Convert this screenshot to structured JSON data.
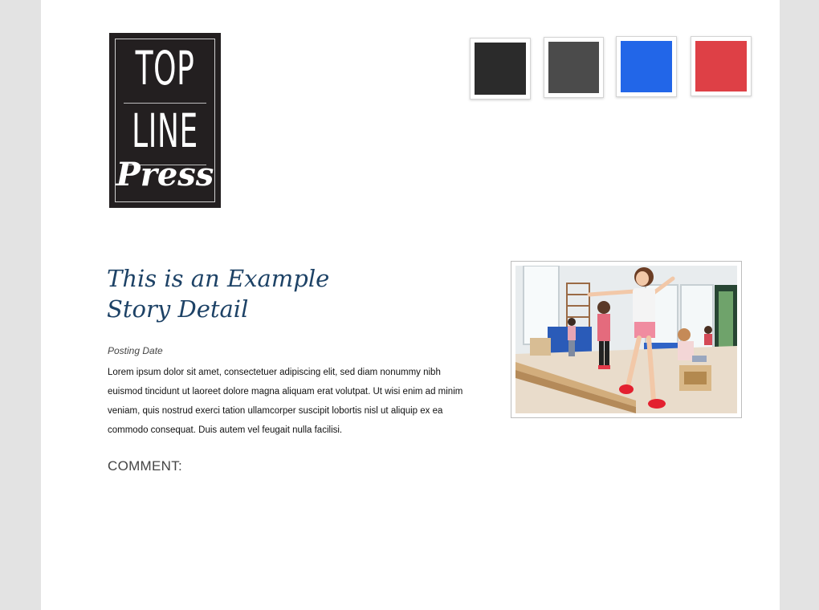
{
  "logo": {
    "line1": "TOP",
    "line2": "LINE",
    "line3": "Press"
  },
  "swatches": [
    {
      "name": "swatch-dark",
      "color": "#2b2b2b"
    },
    {
      "name": "swatch-gray",
      "color": "#4b4b4b"
    },
    {
      "name": "swatch-blue",
      "color": "#2266e8"
    },
    {
      "name": "swatch-red",
      "color": "#de4046"
    }
  ],
  "story": {
    "title_line1": "This is an Example",
    "title_line2": "Story Detail",
    "posting_date": "Posting Date",
    "body": "Lorem ipsum dolor sit amet, consectetuer adipiscing elit, sed diam nonummy nibh euismod tincidunt ut laoreet dolore magna aliquam erat volutpat. Ut wisi enim ad minim veniam, quis nostrud exerci tation ullamcorper suscipit lobortis nisl ut aliquip ex ea commodo consequat. Duis autem vel feugait nulla facilisi.",
    "comment_label": "COMMENT:"
  },
  "colors": {
    "title": "#1d4266",
    "page_background": "#e3e3e3"
  },
  "photo": {
    "icon": "photo-children-balancing"
  }
}
